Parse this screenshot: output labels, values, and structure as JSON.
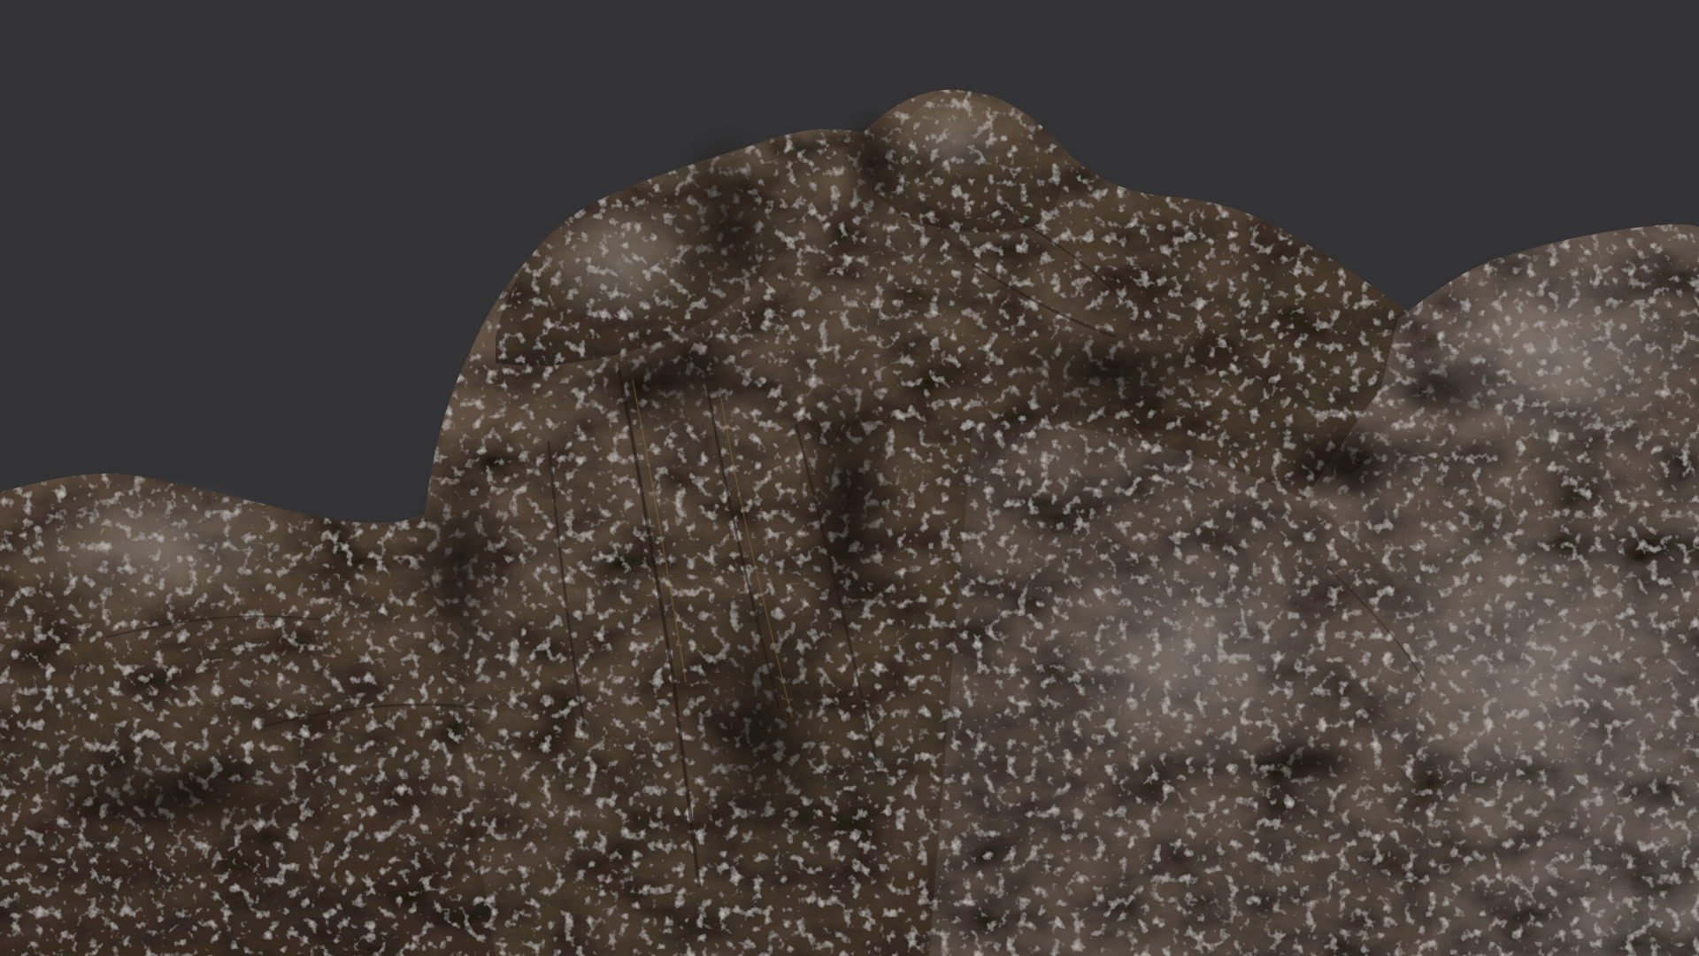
{
  "scene": {
    "subject": "rock-formation-3d-render",
    "colors": {
      "background": "#333335",
      "rock_dark": "#2a221c",
      "rock_mid": "#5a4a3c",
      "rock_light": "#7a6a5c",
      "rock_highlight": "#9a8f86",
      "rock_warm_edge": "#8a6a3a"
    }
  }
}
